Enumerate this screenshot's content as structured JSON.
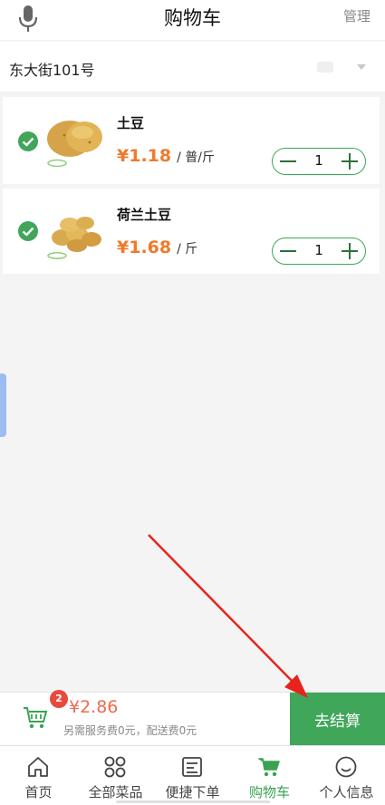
{
  "header": {
    "title": "购物车",
    "manage_label": "管理"
  },
  "address": {
    "text": "东大街101号"
  },
  "cart": {
    "items": [
      {
        "name": "土豆",
        "price": "¥1.18",
        "unit": "/ 普/斤",
        "quantity": "1",
        "selected": true
      },
      {
        "name": "荷兰土豆",
        "price": "¥1.68",
        "unit": "/ 斤",
        "quantity": "1",
        "selected": true
      }
    ]
  },
  "checkout": {
    "badge_count": "2",
    "total": "¥2.86",
    "fees_note": "另需服务费0元，配送费0元",
    "button_label": "去结算"
  },
  "tabbar": {
    "tabs": [
      {
        "label": "首页",
        "icon": "home-icon"
      },
      {
        "label": "全部菜品",
        "icon": "grid-icon"
      },
      {
        "label": "便捷下单",
        "icon": "list-icon"
      },
      {
        "label": "购物车",
        "icon": "cart-icon",
        "active": true
      },
      {
        "label": "个人信息",
        "icon": "smile-icon"
      }
    ]
  },
  "colors": {
    "accent_green": "#40a65a",
    "price_orange": "#f07a2b",
    "badge_red": "#e74a3b",
    "annotation_red": "#e8231c"
  }
}
